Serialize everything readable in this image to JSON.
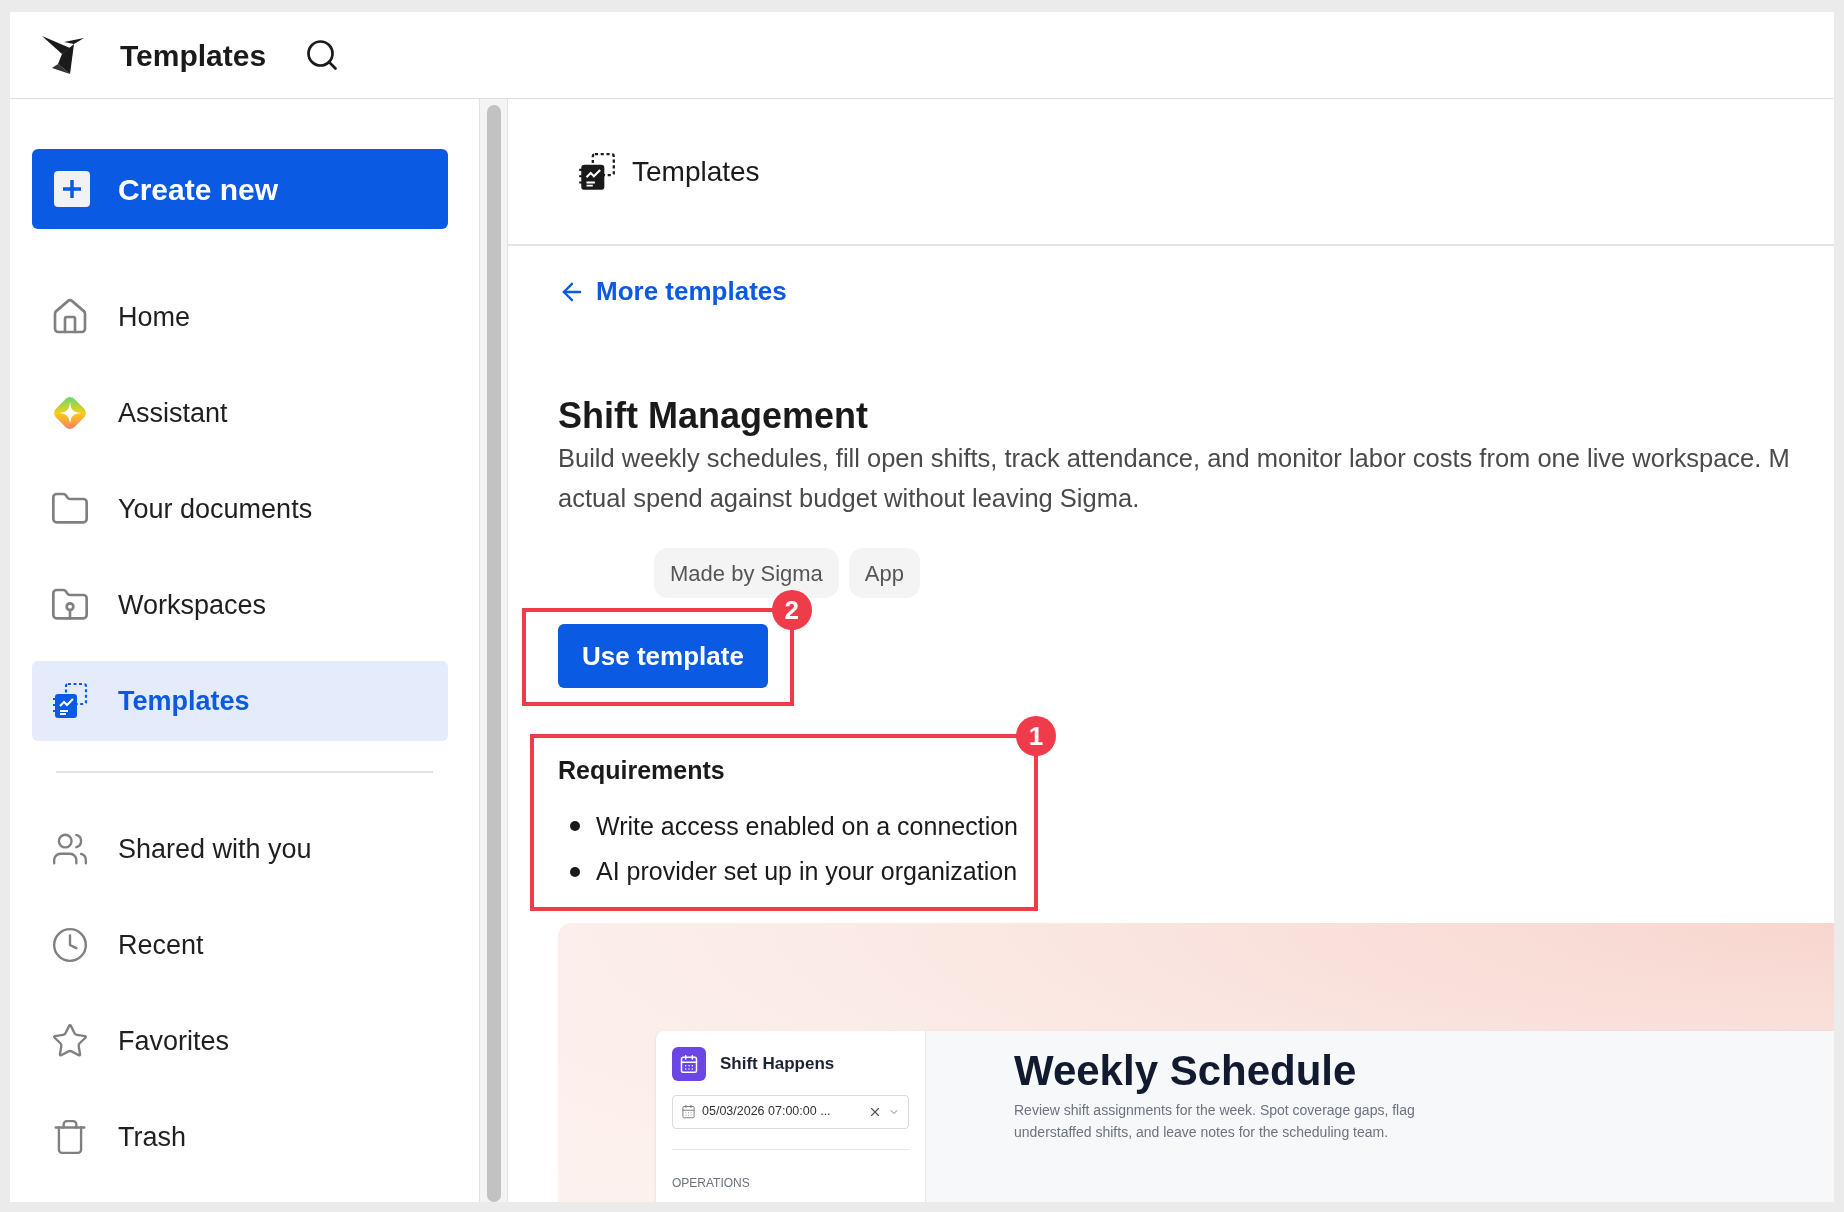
{
  "header": {
    "title": "Templates"
  },
  "sidebar": {
    "create_button": "Create new",
    "items": [
      {
        "label": "Home",
        "selected": false
      },
      {
        "label": "Assistant",
        "selected": false
      },
      {
        "label": "Your documents",
        "selected": false
      },
      {
        "label": "Workspaces",
        "selected": false
      },
      {
        "label": "Templates",
        "selected": true
      }
    ],
    "items_secondary": [
      {
        "label": "Shared with you",
        "selected": false
      },
      {
        "label": "Recent",
        "selected": false
      },
      {
        "label": "Favorites",
        "selected": false
      },
      {
        "label": "Trash",
        "selected": false
      }
    ]
  },
  "main": {
    "title": "Templates",
    "back_link": "More templates",
    "template": {
      "name": "Shift Management",
      "description_lines": [
        "Build weekly schedules, fill open shifts, track attendance, and monitor labor costs from one live workspace. M",
        "actual spend against budget without leaving Sigma."
      ],
      "tags": [
        "Made by Sigma",
        "App"
      ],
      "button": "Use template",
      "button_annotation": "2",
      "requirements": {
        "title": "Requirements",
        "annotation": "1",
        "items": [
          "Write access enabled on a connection",
          "AI provider set up in your organization"
        ]
      }
    },
    "preview": {
      "app_name": "Shift Happens",
      "date_filter": "05/03/2026 07:00:00 ...",
      "section": "OPERATIONS",
      "heading": "Weekly Schedule",
      "description": "Review shift assignments for the week. Spot coverage gaps, flag understaffed shifts, and leave notes for the scheduling team."
    }
  }
}
